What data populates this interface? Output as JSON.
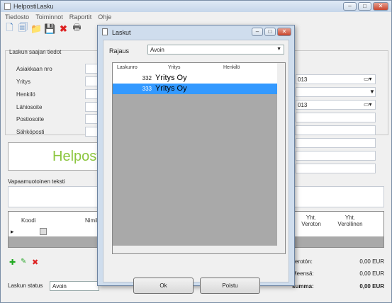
{
  "app": {
    "title": "HelpostiLasku"
  },
  "menu": [
    "Tiedosto",
    "Toiminnot",
    "Raportit",
    "Ohje"
  ],
  "form": {
    "section_title": "Laskun saajan tiedot",
    "labels": [
      "Asiakkaan nro",
      "Yritys",
      "Henkilö",
      "Lähiosoite",
      "Postiosoite",
      "Sähköposti"
    ],
    "date_right_1": "013",
    "date_right_2": "013",
    "free_text_label": "Vapaamuotoinen teksti"
  },
  "logo_text": "Helposti",
  "rows_grid": {
    "headers": [
      "Koodi",
      "Nimike",
      "Yht. Veroton",
      "Yht. Verollinen"
    ]
  },
  "totals": {
    "labels": [
      "verotón:",
      "Meensä:",
      "summa:"
    ],
    "values": [
      "0,00 EUR",
      "0,00 EUR",
      "0,00 EUR"
    ]
  },
  "status": {
    "label": "Laskun status",
    "value": "Avoin"
  },
  "dialog": {
    "title": "Laskut",
    "filter_label": "Rajaus",
    "filter_value": "Avoin",
    "columns": [
      "Laskunro",
      "Yritys",
      "Henkilö"
    ],
    "rows": [
      {
        "no": "332",
        "company": "Yritys Oy"
      },
      {
        "no": "333",
        "company": "Yritys Oy"
      }
    ],
    "ok_label": "Ok",
    "delete_label": "Poistu"
  }
}
